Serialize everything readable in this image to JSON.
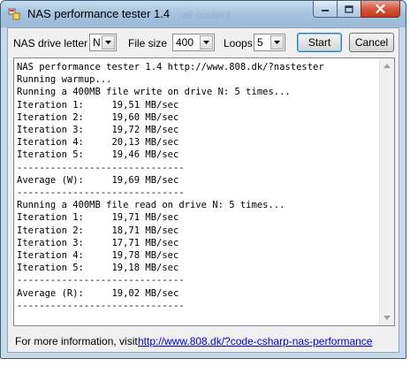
{
  "window": {
    "title": "NAS performance tester 1.4",
    "background_title_ghost": "all content"
  },
  "toolbar": {
    "drive_label": "NAS drive letter",
    "drive_value": "N",
    "filesize_label": "File size",
    "filesize_value": "400",
    "loops_label": "Loops",
    "loops_value": "5",
    "start_label": "Start",
    "cancel_label": "Cancel"
  },
  "output": {
    "lines": [
      "NAS performance tester 1.4 http://www.808.dk/?nastester",
      "Running warmup...",
      "Running a 400MB file write on drive N: 5 times...",
      "Iteration 1:     19,51 MB/sec",
      "Iteration 2:     19,60 MB/sec",
      "Iteration 3:     19,72 MB/sec",
      "Iteration 4:     20,13 MB/sec",
      "Iteration 5:     19,46 MB/sec",
      "------------------------------",
      "Average (W):     19,69 MB/sec",
      "------------------------------",
      "Running a 400MB file read on drive N: 5 times...",
      "Iteration 1:     19,71 MB/sec",
      "Iteration 2:     18,71 MB/sec",
      "Iteration 3:     17,71 MB/sec",
      "Iteration 4:     19,78 MB/sec",
      "Iteration 5:     19,18 MB/sec",
      "------------------------------",
      "Average (R):     19,02 MB/sec",
      "------------------------------"
    ]
  },
  "footer": {
    "info_text": "For more information, visit",
    "link_text": "http://www.808.dk/?code-csharp-nas-performance"
  },
  "colors": {
    "link": "#0000cc",
    "close_button": "#c1391d",
    "title_bar": "#a9c6df"
  }
}
